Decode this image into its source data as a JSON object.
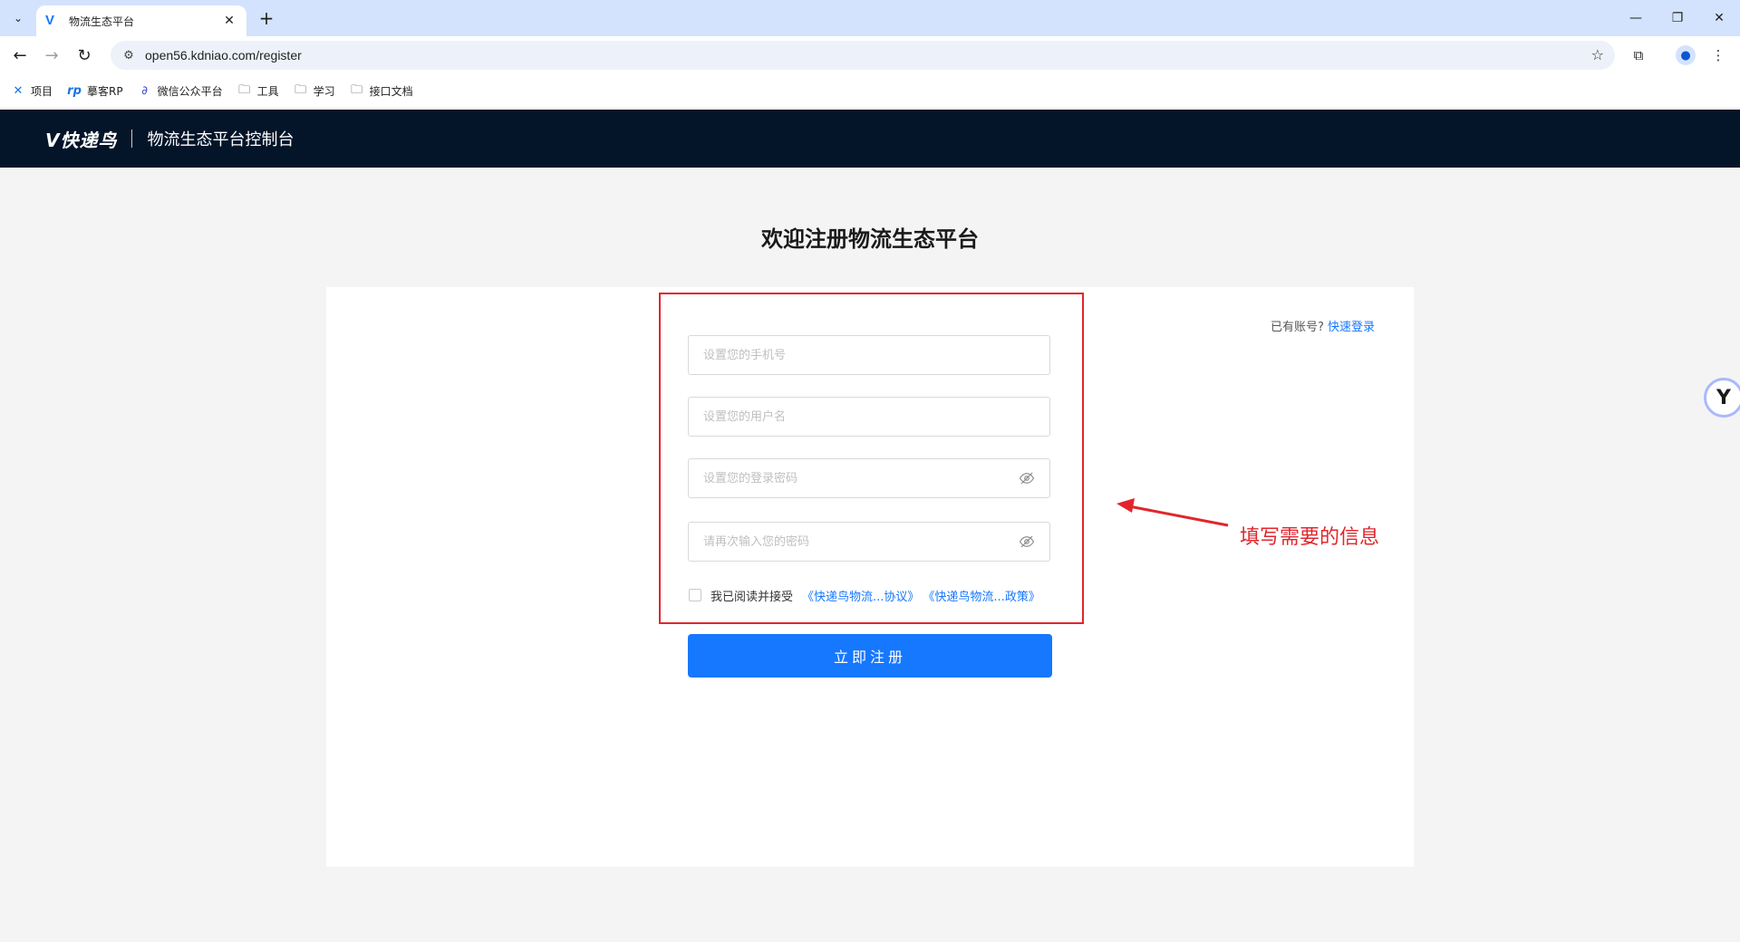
{
  "browser": {
    "tab_title": "物流生态平台",
    "url": "open56.kdniao.com/register",
    "bookmarks": [
      {
        "label": "项目",
        "icon": "x-logo-icon"
      },
      {
        "label": "摹客RP",
        "icon": "rp-logo-icon"
      },
      {
        "label": "微信公众平台",
        "icon": "link-icon"
      },
      {
        "label": "工具",
        "icon": "folder-icon"
      },
      {
        "label": "学习",
        "icon": "folder-icon"
      },
      {
        "label": "接口文档",
        "icon": "folder-icon"
      }
    ]
  },
  "header": {
    "logo": "V快递鸟",
    "title": "物流生态平台控制台"
  },
  "page": {
    "title": "欢迎注册物流生态平台",
    "login_hint": "已有账号?",
    "login_link": "快速登录"
  },
  "form": {
    "phone_placeholder": "设置您的手机号",
    "username_placeholder": "设置您的用户名",
    "password_placeholder": "设置您的登录密码",
    "confirm_placeholder": "请再次输入您的密码",
    "agree_text": "我已阅读并接受",
    "agreement_link": "《快递鸟物流...协议》",
    "policy_link": "《快递鸟物流...政策》",
    "submit_label": "立即注册"
  },
  "annotation": {
    "text": "填写需要的信息",
    "color": "#e0262c"
  },
  "colors": {
    "primary": "#1677ff",
    "header_bg": "#041529"
  }
}
